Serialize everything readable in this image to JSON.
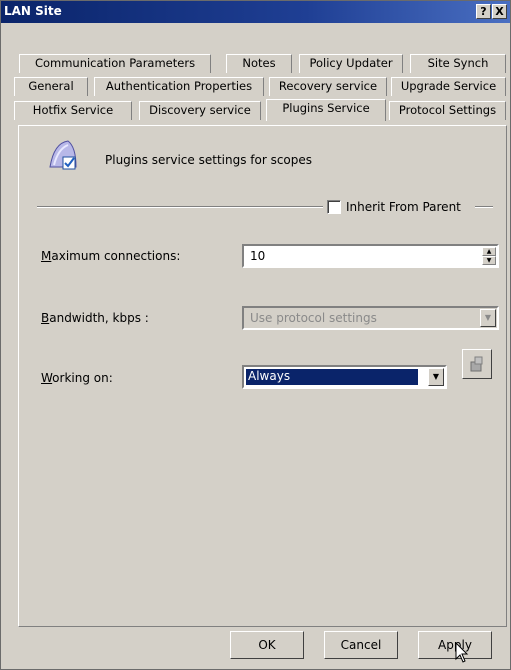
{
  "window": {
    "title": "LAN Site",
    "help_label": "?",
    "close_label": "X"
  },
  "tabs": {
    "row1": [
      "Communication Parameters",
      "Notes",
      "Policy Updater",
      "Site Synch"
    ],
    "row2": [
      "General",
      "Authentication Properties",
      "Recovery service",
      "Upgrade Service"
    ],
    "row3": [
      "Hotfix Service",
      "Discovery service",
      "Plugins Service",
      "Protocol Settings"
    ],
    "active": "Plugins Service"
  },
  "panel": {
    "heading": "Plugins service settings for scopes",
    "inherit_label": "Inherit From Parent",
    "inherit_checked": false,
    "max_connections": {
      "label": "Maximum connections:",
      "value": "10"
    },
    "bandwidth": {
      "label": "Bandwidth, kbps :",
      "value": "Use protocol settings"
    },
    "working_on": {
      "label": "Working on:",
      "value": "Always"
    }
  },
  "buttons": {
    "ok": "OK",
    "cancel": "Cancel",
    "apply": "Apply"
  },
  "icons": {
    "app": "plugins-scope-icon",
    "edit": "schedule-edit-icon"
  },
  "colors": {
    "title_bar": "#0a246a",
    "selection": "#0a246a",
    "face": "#d4d0c8"
  }
}
